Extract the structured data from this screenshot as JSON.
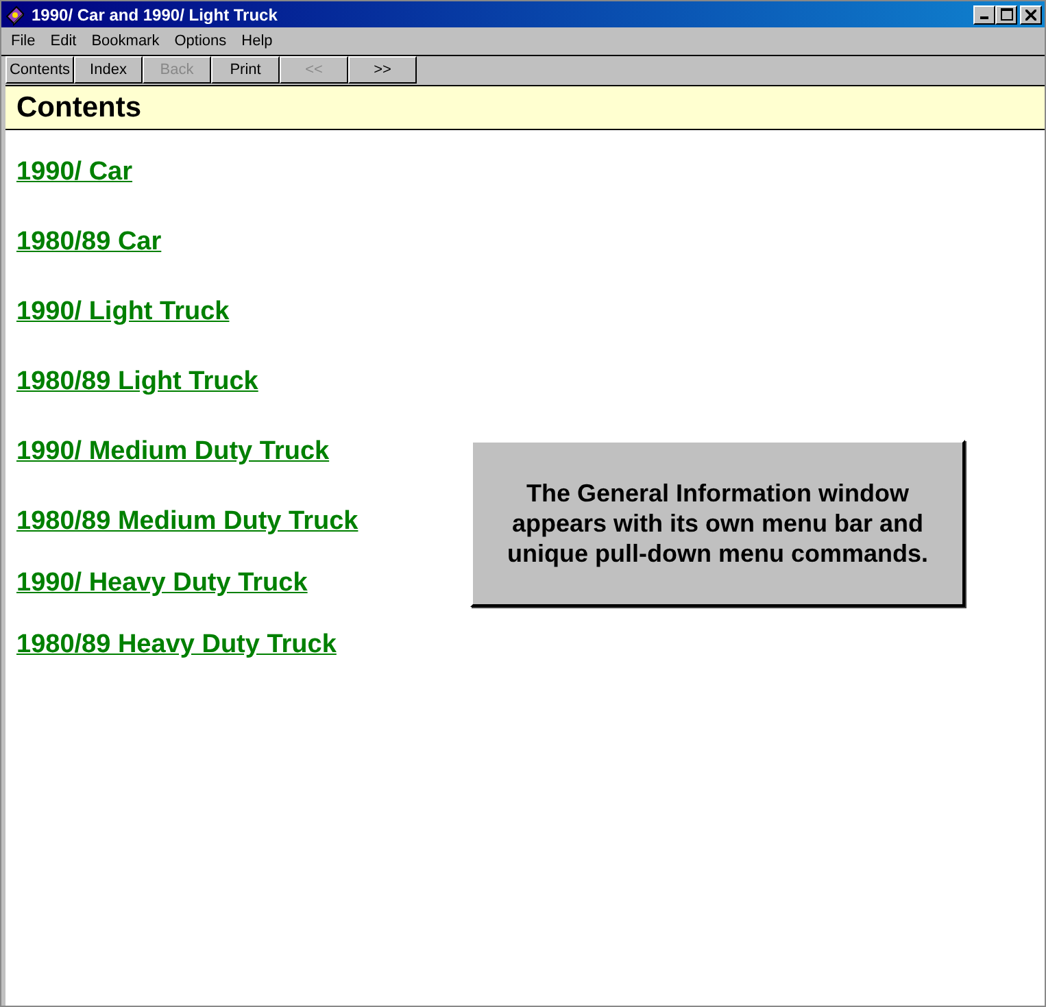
{
  "window": {
    "title": "1990/ Car and 1990/ Light Truck"
  },
  "menu": [
    "File",
    "Edit",
    "Bookmark",
    "Options",
    "Help"
  ],
  "buttons": [
    {
      "label": "Contents",
      "disabled": false
    },
    {
      "label": "Index",
      "disabled": false
    },
    {
      "label": "Back",
      "disabled": true
    },
    {
      "label": "Print",
      "disabled": false
    },
    {
      "label": "<<",
      "disabled": true
    },
    {
      "label": ">>",
      "disabled": false
    }
  ],
  "heading": "Contents",
  "links": [
    "1990/ Car",
    "1980/89 Car",
    "1990/ Light Truck",
    "1980/89 Light Truck",
    "1990/ Medium Duty Truck",
    "1980/89 Medium Duty Truck",
    "1990/ Heavy Duty Truck",
    "1980/89 Heavy Duty Truck"
  ],
  "callout": "The General Information window appears with its own menu bar and unique pull-down menu commands."
}
